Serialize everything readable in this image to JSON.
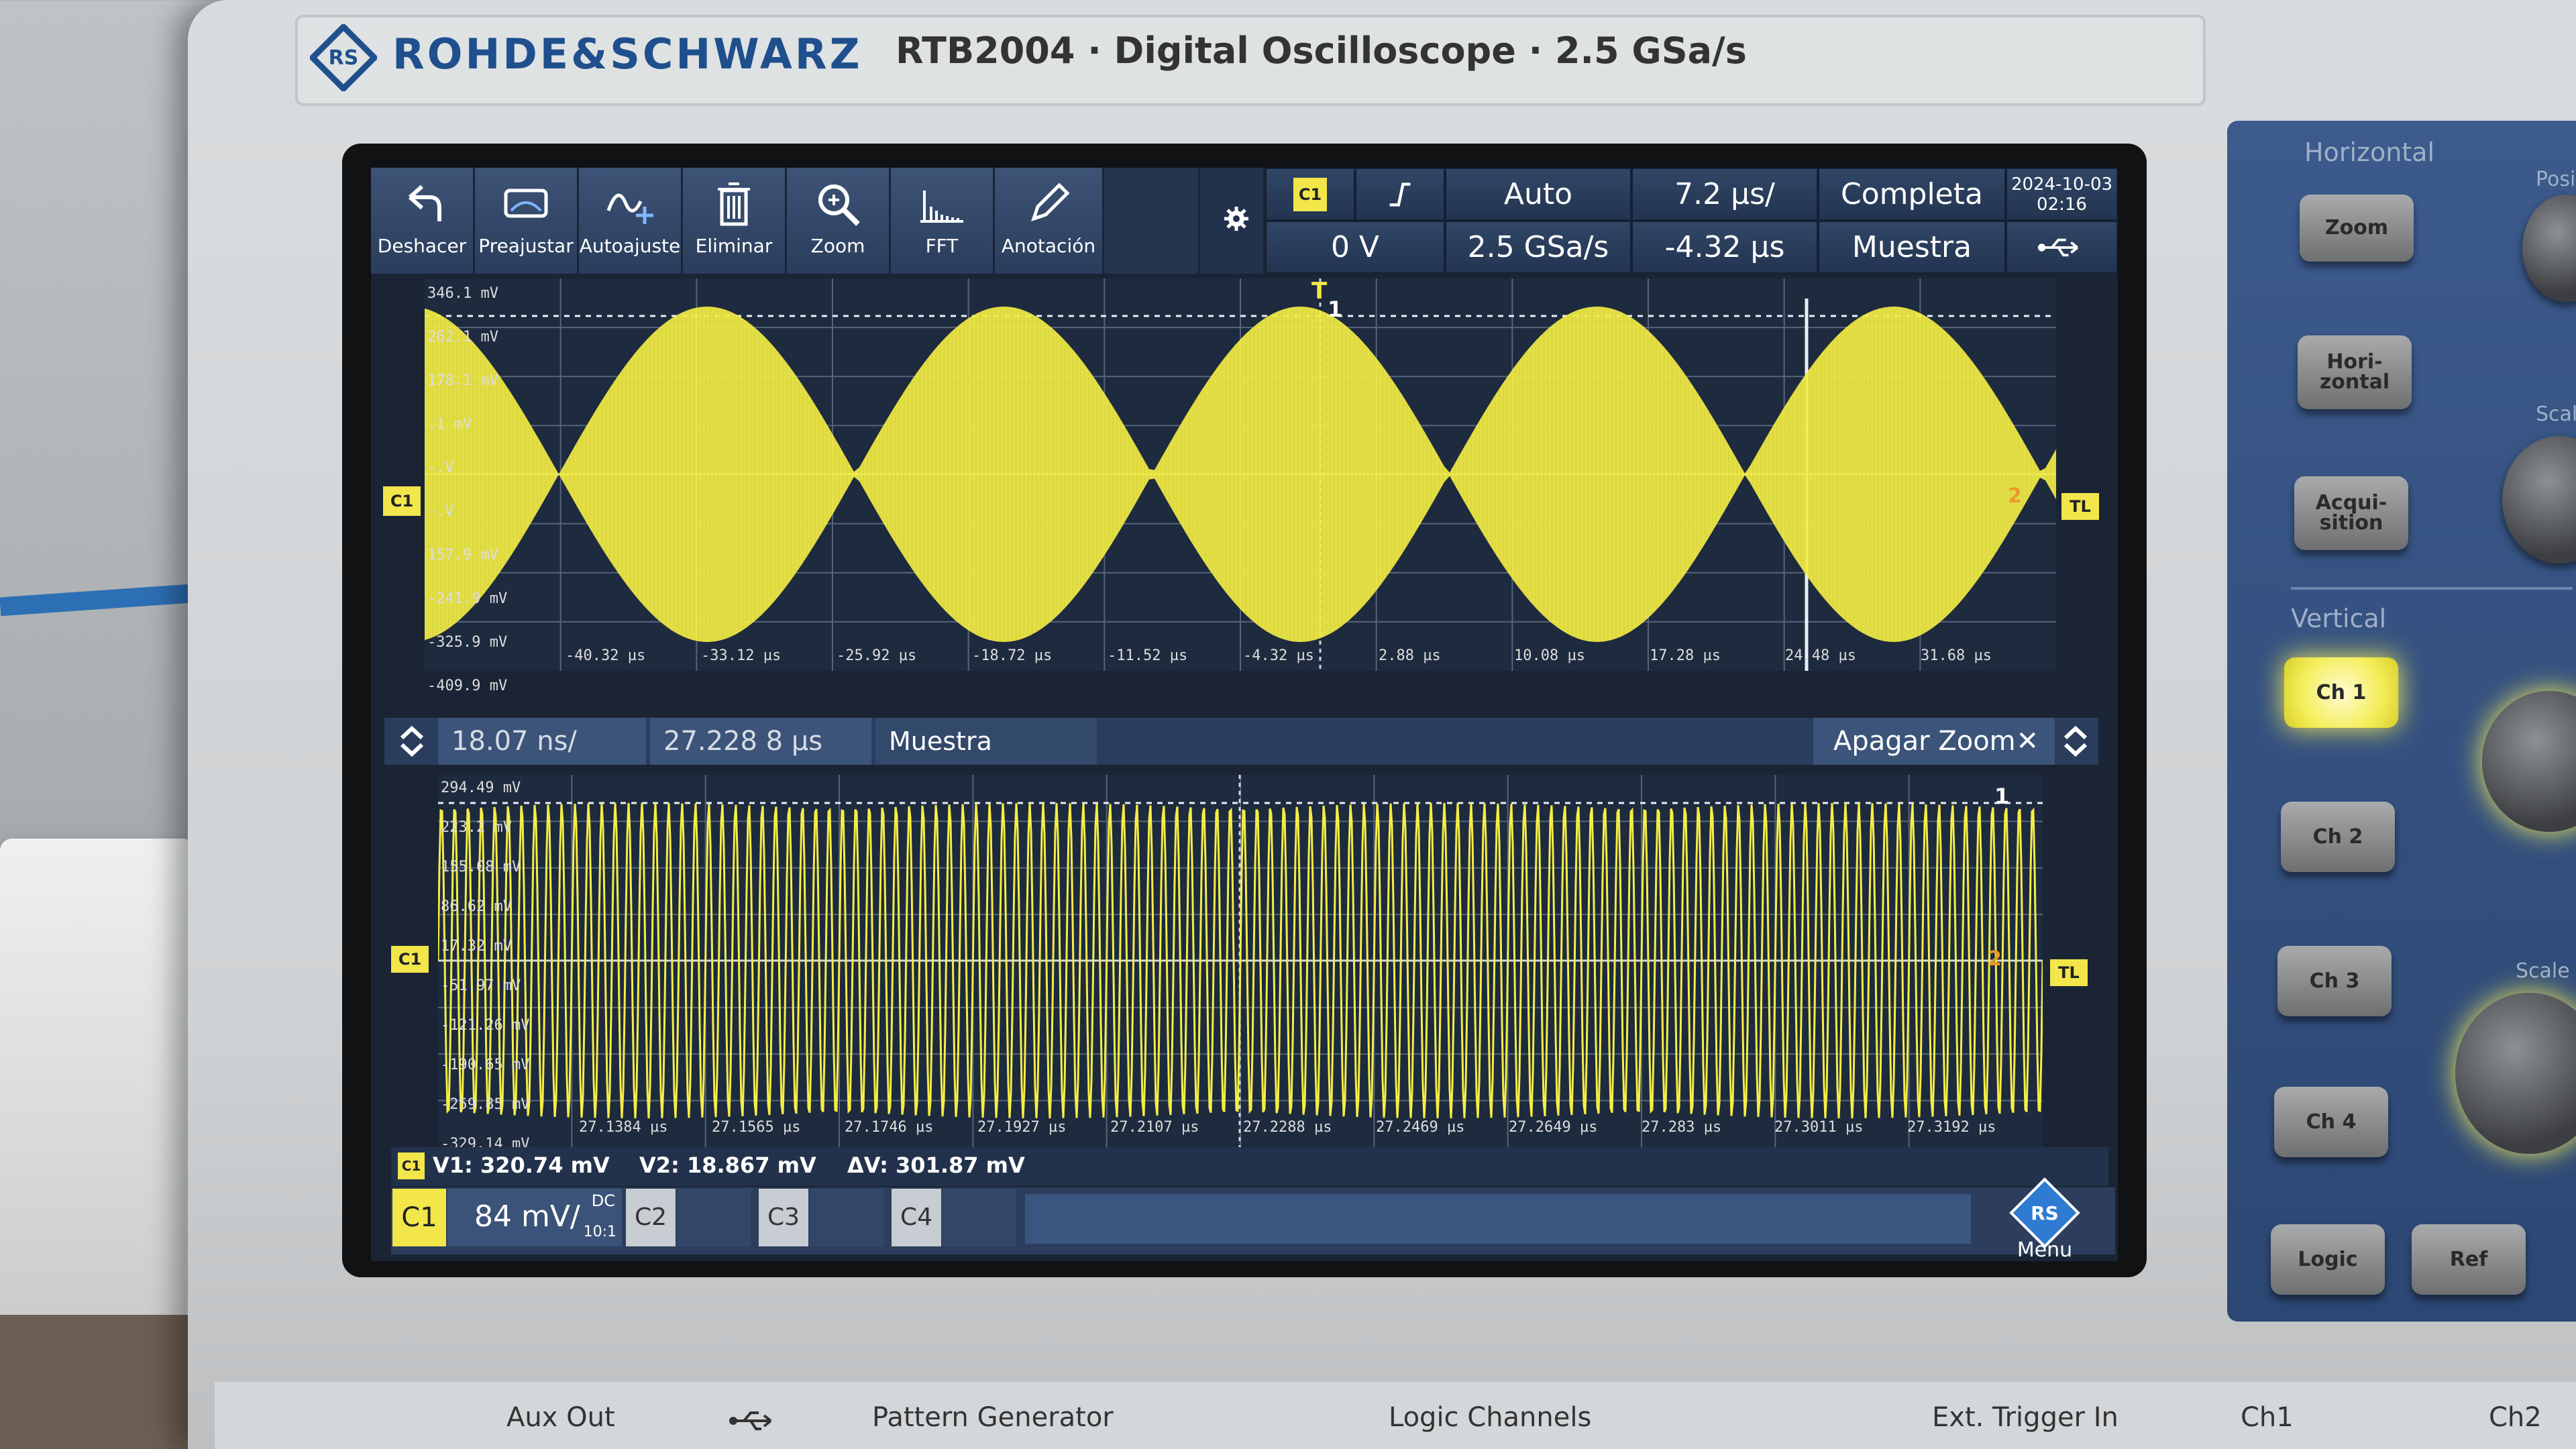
{
  "brand": {
    "name": "ROHDE&SCHWARZ",
    "model_line": "RTB2004 · Digital Oscilloscope · 2.5 GSa/s"
  },
  "toolbar": {
    "tools": [
      {
        "label": "Deshacer",
        "icon": "undo-icon"
      },
      {
        "label": "Preajustar",
        "icon": "preset-icon"
      },
      {
        "label": "Autoajuste",
        "icon": "autoset-icon"
      },
      {
        "label": "Eliminar",
        "icon": "trash-icon"
      },
      {
        "label": "Zoom",
        "icon": "zoom-icon"
      },
      {
        "label": "FFT",
        "icon": "fft-icon"
      },
      {
        "label": "Anotación",
        "icon": "pencil-icon"
      }
    ],
    "settings_icon": "gear-icon"
  },
  "status": {
    "trigger_source": "C1",
    "trigger_slope": "rising-edge",
    "trigger_level": "0 V",
    "trigger_mode": "Auto",
    "sample_rate": "2.5 GSa/s",
    "time_scale": "7.2 µs/",
    "time_position": "-4.32 µs",
    "memory": "Completa",
    "acquisition": "Muestra",
    "date": "2024-10-03",
    "time": "02:16",
    "usb_icon": "usb-icon"
  },
  "main_view": {
    "y_labels": [
      "346.1 mV",
      "262.1 mV",
      "178.1 mV",
      ".1 mV",
      "-.V",
      "-.V",
      "157.9 mV",
      "-241.9 mV",
      "-325.9 mV",
      "-409.9 mV"
    ],
    "x_labels": [
      "-40.32 µs",
      "-33.12 µs",
      "-25.92 µs",
      "-18.72 µs",
      "-11.52 µs",
      "-4.32 µs",
      "2.88 µs",
      "10.08 µs",
      "17.28 µs",
      "24.48 µs",
      "31.68 µs"
    ],
    "channel_marker": "C1",
    "trigger_level_marker": "TL",
    "trigger_marker": "T",
    "cursor_1": "1",
    "cursor_2": "2",
    "signal": {
      "type": "AM modulated sine",
      "envelope_cycles": 5.5,
      "peak_mv": 320,
      "color": "#f4ee44"
    }
  },
  "zoom_bar": {
    "time_scale": "18.07 ns/",
    "position": "27.228 8 µs",
    "acquisition": "Muestra",
    "close_label": "Apagar Zoom",
    "close_icon": "close-icon"
  },
  "zoom_view": {
    "y_labels": [
      "294.49 mV",
      "223.2 mV",
      "155.08 mV",
      "86.62 mV",
      "17.32 mV",
      "-51.97 mV",
      "-121.26 mV",
      "-190.65 mV",
      "-259.85 mV",
      "-329.14 mV"
    ],
    "x_labels": [
      "27.1384 µs",
      "27.1565 µs",
      "27.1746 µs",
      "27.1927 µs",
      "27.2107 µs",
      "27.2288 µs",
      "27.2469 µs",
      "27.2649 µs",
      "27.283 µs",
      "27.3011 µs",
      "27.3192 µs"
    ],
    "channel_marker": "C1",
    "trigger_level_marker": "TL",
    "cursor_1": "1",
    "cursor_2": "2"
  },
  "cursor_readout": {
    "channel": "C1",
    "v1": "V1: 320.74 mV",
    "v2": "V2: 18.867 mV",
    "delta": "ΔV: 301.87 mV"
  },
  "channel_bar": {
    "c1_label": "C1",
    "c1_scale": "84 mV/",
    "c1_coupling": "DC",
    "c1_probe": "10:1",
    "c2_label": "C2",
    "c3_label": "C3",
    "c4_label": "C4",
    "menu_label": "Menu",
    "menu_icon": "rs-menu-icon"
  },
  "front_panel": {
    "horizontal_title": "Horizontal",
    "zoom_button": "Zoom",
    "horizontal_button": "Hori-\nzontal",
    "acquisition_button": "Acqui-\nsition",
    "vertical_title": "Vertical",
    "channel_buttons": [
      "Ch 1",
      "Ch 2",
      "Ch 3",
      "Ch 4"
    ],
    "logic_button": "Logic",
    "ref_button": "Ref",
    "position_label": "Posi",
    "scale_label": "Scal",
    "vertical_scale_label": "Scale"
  },
  "connectors": [
    "Aux Out",
    "Pattern Generator",
    "Logic Channels",
    "Ext. Trigger In",
    "Ch1",
    "Ch2"
  ],
  "colors": {
    "channel1": "#f4ee44",
    "screen_bg": "#1b2434",
    "toolbar": "#2f4566",
    "brand_blue": "#1f4f8d"
  }
}
